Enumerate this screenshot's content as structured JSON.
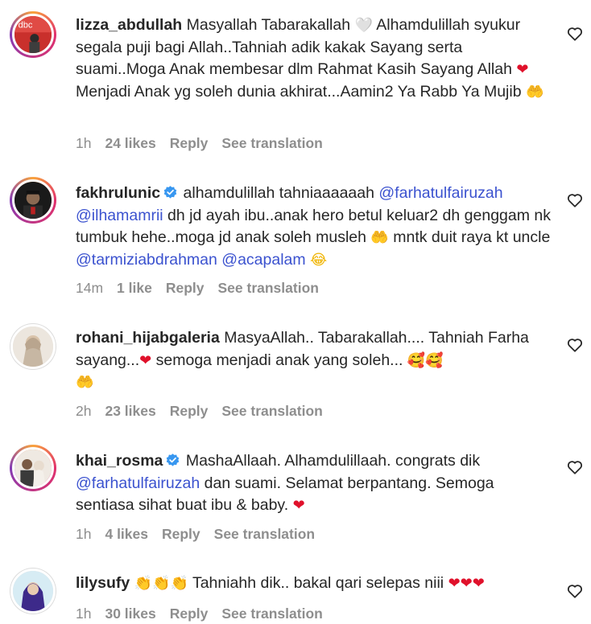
{
  "comments": [
    {
      "username": "lizza_abdullah",
      "verified": false,
      "text": [
        "Masyallah Tabarakallah ",
        " Alhamdulillah syukur segala puji bagi Allah..Tahniah adik kakak Sayang serta suami..Moga Anak membesar dlm Rahmat Kasih Sayang Allah ",
        " Menjadi Anak yg soleh dunia akhirat...Aamin2 Ya Rabb Ya Mujib "
      ],
      "time": "1h",
      "likes": "24 likes",
      "reply": "Reply",
      "translate": "See translation"
    },
    {
      "username": "fakhrulunic",
      "verified": true,
      "text": [
        "alhamdulillah tahniaaaaaah ",
        "@farhatulfairuzah",
        " ",
        "@ilhamamrii",
        " dh jd ayah ibu..anak hero betul keluar2 dh genggam nk tumbuk hehe..moga jd anak soleh musleh ",
        " mntk duit raya kt uncle ",
        "@tarmiziabdrahman",
        " ",
        "@acapalam",
        " "
      ],
      "time": "14m",
      "likes": "1 like",
      "reply": "Reply",
      "translate": "See translation"
    },
    {
      "username": "rohani_hijabgaleria",
      "verified": false,
      "text": [
        "MasyaAllah.. Tabarakallah.... Tahniah Farha sayang...",
        " semoga menjadi anak yang soleh... "
      ],
      "time": "2h",
      "likes": "23 likes",
      "reply": "Reply",
      "translate": "See translation"
    },
    {
      "username": "khai_rosma",
      "verified": true,
      "text": [
        "MashaAllaah. Alhamdulillaah. congrats dik ",
        "@farhatulfairuzah",
        " dan suami. Selamat berpantang. Semoga sentiasa sihat buat ibu & baby. "
      ],
      "time": "1h",
      "likes": "4 likes",
      "reply": "Reply",
      "translate": "See translation"
    },
    {
      "username": "lilysufy",
      "verified": false,
      "text": [
        " Tahniahh dik.. bakal qari selepas niii "
      ],
      "time": "1h",
      "likes": "30 likes",
      "reply": "Reply",
      "translate": "See translation"
    }
  ],
  "emoji": {
    "white_heart": "🤍",
    "red_heart": "❤",
    "raising_hands": "🤲",
    "laugh": "😂",
    "smiling_hearts": "🥰🥰",
    "clap": "👏👏👏",
    "three_hearts": "❤❤❤"
  },
  "icons": {
    "like": "heart-outline-icon",
    "verified": "verified-badge-icon"
  },
  "colors": {
    "mention": "#3b52cf",
    "meta": "#8e8e8e",
    "verified": "#3897f0"
  }
}
